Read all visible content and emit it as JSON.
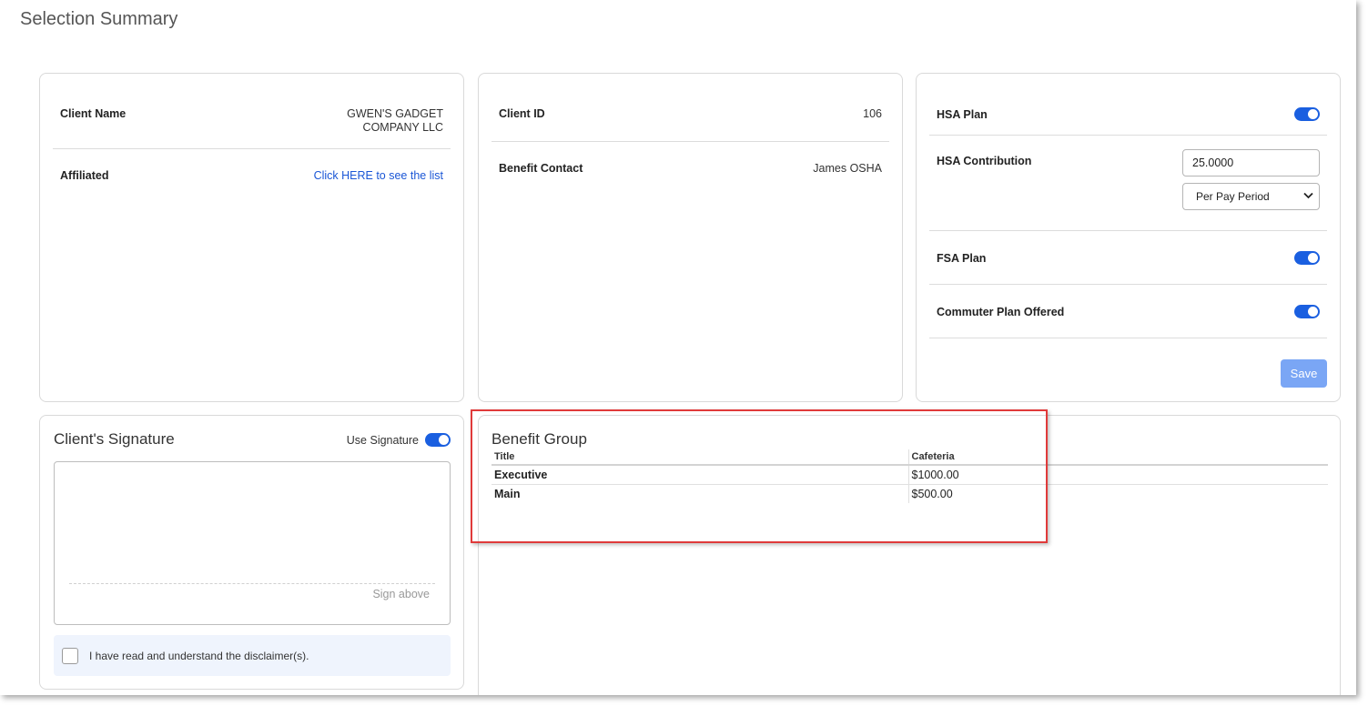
{
  "page": {
    "title": "Selection Summary"
  },
  "client_card": {
    "client_name_label": "Client Name",
    "client_name_line1": "GWEN'S GADGET",
    "client_name_line2": "COMPANY LLC",
    "affiliated_label": "Affiliated",
    "affiliated_link": "Click HERE to see the list"
  },
  "id_card": {
    "client_id_label": "Client ID",
    "client_id_value": "106",
    "benefit_contact_label": "Benefit Contact",
    "benefit_contact_value": "James OSHA"
  },
  "plans_card": {
    "hsa_plan_label": "HSA Plan",
    "hsa_plan_enabled": true,
    "hsa_contribution_label": "HSA Contribution",
    "hsa_contribution_value": "25.0000",
    "hsa_frequency_selected": "Per Pay Period",
    "fsa_plan_label": "FSA Plan",
    "fsa_plan_enabled": true,
    "commuter_plan_label": "Commuter Plan Offered",
    "commuter_plan_enabled": true,
    "save_label": "Save"
  },
  "signature_card": {
    "title": "Client's Signature",
    "use_signature_label": "Use Signature",
    "use_signature_enabled": true,
    "sign_hint": "Sign above",
    "disclaimer_text": "I have read and understand the disclaimer(s)."
  },
  "benefit_group": {
    "title": "Benefit Group",
    "columns": [
      "Title",
      "Cafeteria"
    ],
    "rows": [
      {
        "title": "Executive",
        "cafeteria": "$1000.00"
      },
      {
        "title": "Main",
        "cafeteria": "$500.00"
      }
    ]
  },
  "colors": {
    "accent": "#1a5fe0",
    "link": "#1a56d6",
    "save_button": "#7aa6f5",
    "highlight_border": "#e03a3a",
    "disclaimer_bg": "#eff4fd"
  }
}
